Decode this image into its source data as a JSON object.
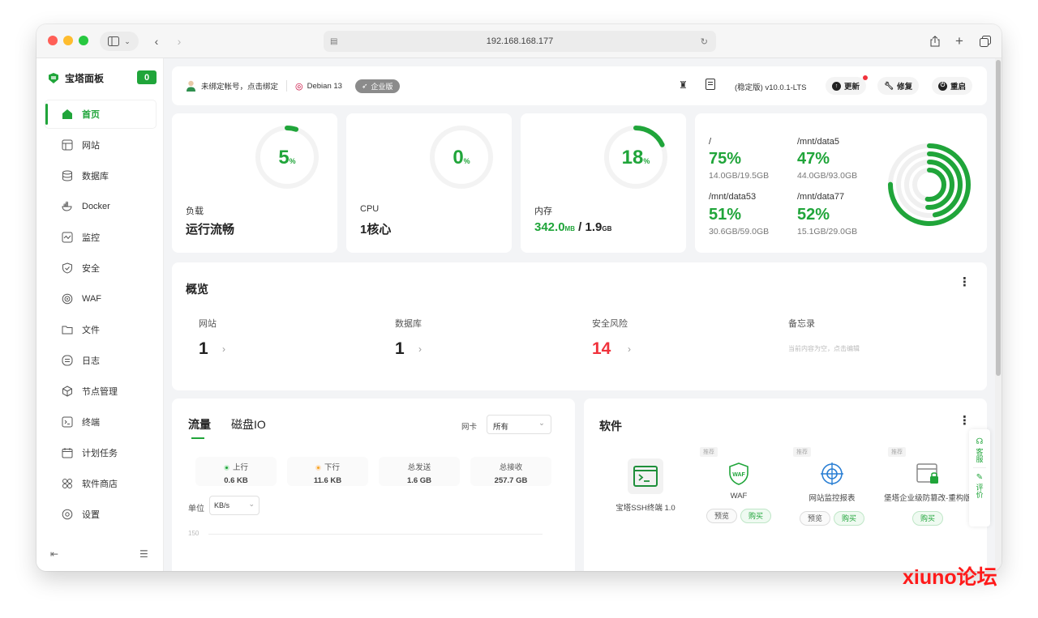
{
  "browser": {
    "url": "192.168.168.177"
  },
  "sidebar": {
    "brand": "宝塔面板",
    "badge": "0",
    "items": [
      {
        "label": "首页",
        "icon": "home-icon"
      },
      {
        "label": "网站",
        "icon": "website-icon"
      },
      {
        "label": "数据库",
        "icon": "database-icon"
      },
      {
        "label": "Docker",
        "icon": "docker-icon"
      },
      {
        "label": "监控",
        "icon": "monitor-icon"
      },
      {
        "label": "安全",
        "icon": "shield-icon"
      },
      {
        "label": "WAF",
        "icon": "waf-icon"
      },
      {
        "label": "文件",
        "icon": "folder-icon"
      },
      {
        "label": "日志",
        "icon": "log-icon"
      },
      {
        "label": "节点管理",
        "icon": "node-icon"
      },
      {
        "label": "终端",
        "icon": "terminal-icon"
      },
      {
        "label": "计划任务",
        "icon": "calendar-icon"
      },
      {
        "label": "软件商店",
        "icon": "store-icon"
      },
      {
        "label": "设置",
        "icon": "settings-icon"
      }
    ]
  },
  "topbar": {
    "account": "未绑定帐号，点击绑定",
    "os": "Debian 13",
    "edition": "企业版",
    "version": "(稳定版) v10.0.1-LTS",
    "update": "更新",
    "repair": "修复",
    "restart": "重启"
  },
  "stats": {
    "load": {
      "value": "5",
      "unit": "%",
      "label": "负载",
      "status": "运行流畅",
      "percent": 5
    },
    "cpu": {
      "value": "0",
      "unit": "%",
      "label": "CPU",
      "status": "1核心",
      "percent": 0
    },
    "memory": {
      "value": "18",
      "unit": "%",
      "label": "内存",
      "used": "342.0",
      "used_unit": "MB",
      "sep": " / ",
      "total": "1.9",
      "total_unit": "GB",
      "percent": 18
    }
  },
  "disks": [
    {
      "name": "/",
      "pct": "75%",
      "size": "14.0GB/19.5GB",
      "percent": 75
    },
    {
      "name": "/mnt/data5",
      "pct": "47%",
      "size": "44.0GB/93.0GB",
      "percent": 47
    },
    {
      "name": "/mnt/data53",
      "pct": "51%",
      "size": "30.6GB/59.0GB",
      "percent": 51
    },
    {
      "name": "/mnt/data77",
      "pct": "52%",
      "size": "15.1GB/29.0GB",
      "percent": 52
    }
  ],
  "overview": {
    "title": "概览",
    "items": [
      {
        "label": "网站",
        "value": "1"
      },
      {
        "label": "数据库",
        "value": "1"
      },
      {
        "label": "安全风险",
        "value": "14"
      },
      {
        "label": "备忘录",
        "note": "当前内容为空，点击编辑"
      }
    ]
  },
  "traffic": {
    "tabs": [
      "流量",
      "磁盘IO"
    ],
    "nic_label": "网卡",
    "nic_value": "所有",
    "stats": [
      {
        "label": "上行",
        "value": "0.6 KB"
      },
      {
        "label": "下行",
        "value": "11.6 KB"
      },
      {
        "label": "总发送",
        "value": "1.6 GB"
      },
      {
        "label": "总接收",
        "value": "257.7 GB"
      }
    ],
    "unit_label": "单位",
    "unit_value": "KB/s",
    "y_tick": "150"
  },
  "software": {
    "title": "软件",
    "items": [
      {
        "name": "宝塔SSH终端 1.0",
        "tag": ""
      },
      {
        "name": "WAF",
        "tag": "推荐",
        "btns": [
          "预览",
          "购买"
        ]
      },
      {
        "name": "网站监控报表",
        "tag": "推荐",
        "btns": [
          "预览",
          "购买"
        ]
      },
      {
        "name": "堡塔企业级防篡改-重构版",
        "tag": "推荐",
        "btns": [
          "购买"
        ]
      }
    ]
  },
  "float_bar": {
    "service": "客服",
    "review": "评价"
  },
  "watermark": "xiuno论坛",
  "colors": {
    "accent": "#20a53a",
    "danger": "#f0323c"
  }
}
